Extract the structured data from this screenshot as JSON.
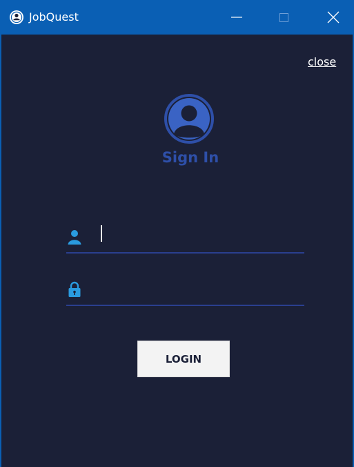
{
  "window": {
    "title": "JobQuest",
    "titlebar_color": "#0a5fb4",
    "background_color": "#1b2037"
  },
  "titlebar_buttons": {
    "minimize_icon": "minimize-icon",
    "maximize_icon": "maximize-icon",
    "close_icon": "close-icon"
  },
  "header": {
    "close_link": "close",
    "avatar_icon": "user-circle-icon",
    "title": "Sign In",
    "title_color": "#2e4fa8"
  },
  "form": {
    "username": {
      "icon": "user-icon",
      "value": "",
      "placeholder": ""
    },
    "password": {
      "icon": "lock-icon",
      "value": "",
      "placeholder": ""
    },
    "login_label": "LOGIN"
  }
}
